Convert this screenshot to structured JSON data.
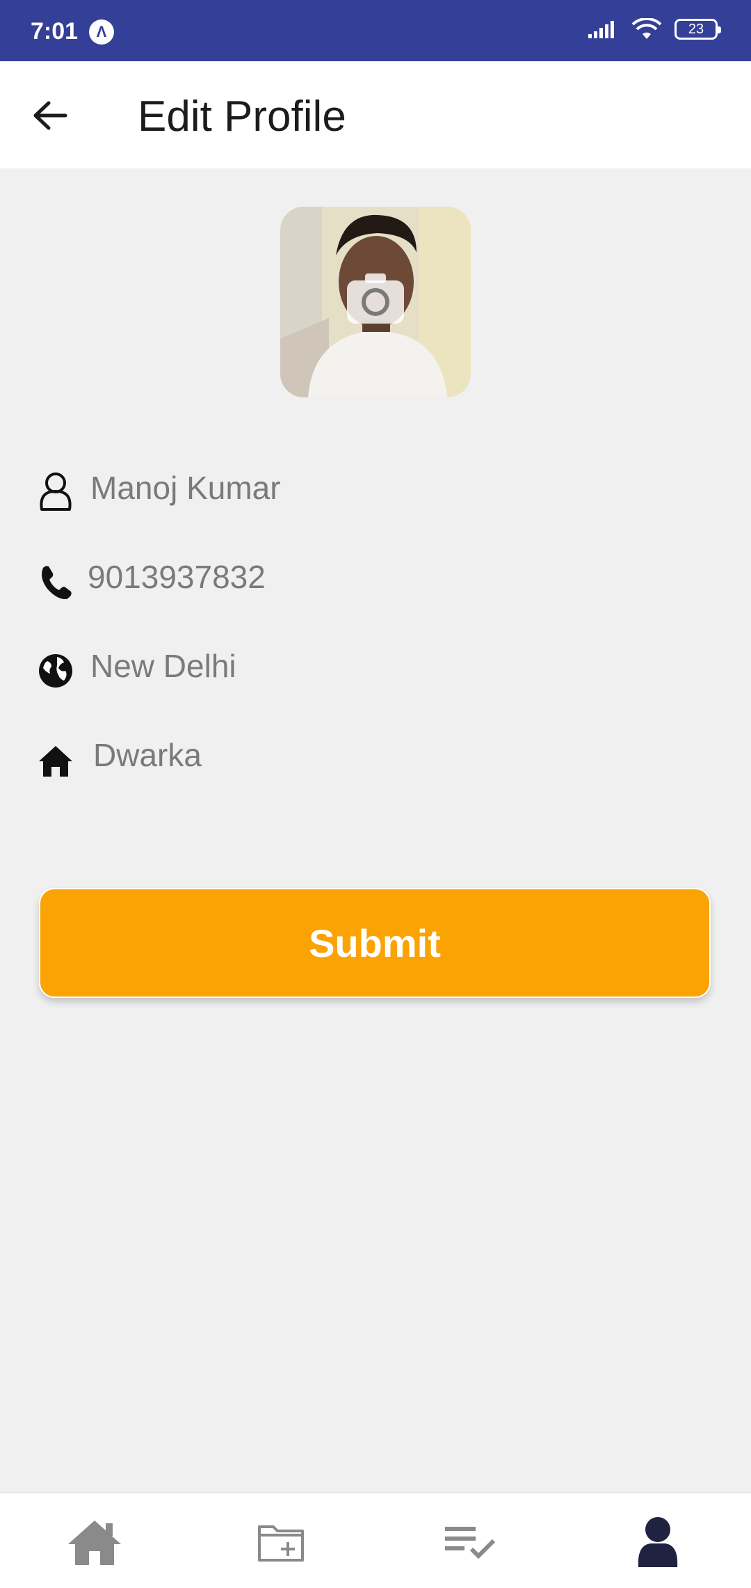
{
  "status_bar": {
    "time": "7:01",
    "app_badge": "Λ",
    "battery": "23"
  },
  "header": {
    "title": "Edit Profile",
    "back_icon": "arrow-left-icon"
  },
  "profile": {
    "avatar_icon": "camera-icon",
    "fields": {
      "name": "Manoj Kumar",
      "phone": "9013937832",
      "city": "New Delhi",
      "locality": "Dwarka"
    }
  },
  "actions": {
    "submit_label": "Submit"
  },
  "bottom_nav": {
    "items": [
      "home-icon",
      "new-folder-icon",
      "task-list-icon",
      "profile-icon"
    ],
    "active": "profile-icon",
    "active_color": "#1f2240",
    "inactive_color": "#8a8a8a"
  },
  "colors": {
    "status_bar": "#344097",
    "accent": "#fba302",
    "background": "#f0f0f0"
  }
}
